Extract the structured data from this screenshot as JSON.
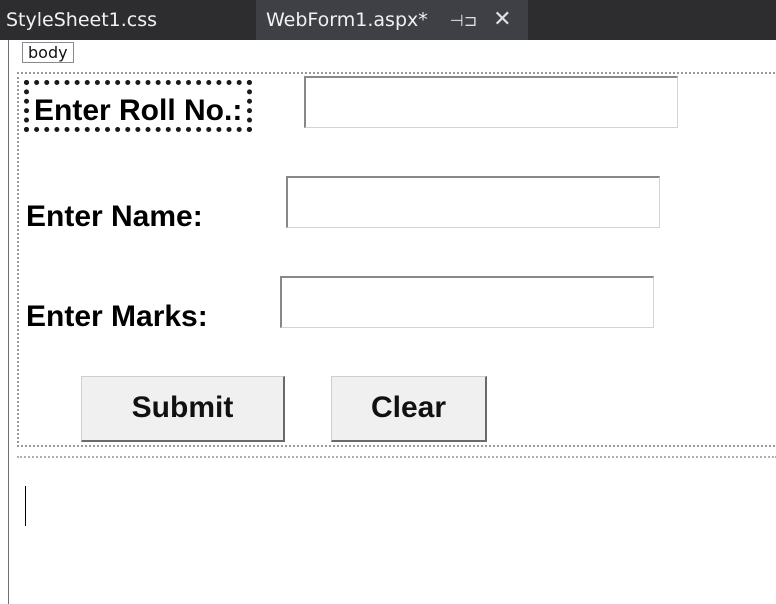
{
  "tabs": [
    {
      "label": "StyleSheet1.css",
      "active": false
    },
    {
      "label": "WebForm1.aspx*",
      "active": true,
      "pin_icon": "pin-icon",
      "close_icon": "close-icon"
    }
  ],
  "breadcrumb": {
    "tag": "body"
  },
  "form": {
    "roll_label": "Enter Roll No.:",
    "roll_value": "",
    "name_label": "Enter Name:",
    "name_value": "",
    "marks_label": "Enter Marks:",
    "marks_value": "",
    "submit_label": "Submit",
    "clear_label": "Clear"
  },
  "colors": {
    "tabbar_bg": "#2d2d30",
    "active_tab_bg": "#3f3f46",
    "button_bg": "#f0f0f0"
  }
}
